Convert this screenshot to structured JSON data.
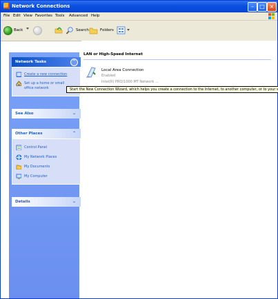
{
  "window": {
    "title": "Network Connections"
  },
  "menubar": {
    "items": [
      "File",
      "Edit",
      "View",
      "Favorites",
      "Tools",
      "Advanced",
      "Help"
    ]
  },
  "toolbar": {
    "back": "Back",
    "search": "Search",
    "folders": "Folders"
  },
  "sidebar": {
    "network_tasks": {
      "title": "Network Tasks",
      "items": [
        "Create a new connection",
        "Set up a home or small",
        "office network"
      ]
    },
    "see_also": {
      "title": "See Also"
    },
    "other_places": {
      "title": "Other Places",
      "items": [
        "Control Panel",
        "My Network Places",
        "My Documents",
        "My Computer"
      ]
    },
    "details": {
      "title": "Details"
    }
  },
  "content": {
    "group_title": "LAN or High-Speed Internet",
    "connection": {
      "name": "Local Area Connection",
      "status": "Enabled",
      "device": "Intel(R) PRO/1000 MT Network ..."
    }
  },
  "tooltip": "Start the New Connection Wizard, which helps you create a connection to the Internet, to another computer, or to your workplace",
  "colors": {
    "title_blue": "#0a4fe0",
    "sidebar_blue": "#7aa2f7",
    "link_blue": "#215dc6"
  }
}
